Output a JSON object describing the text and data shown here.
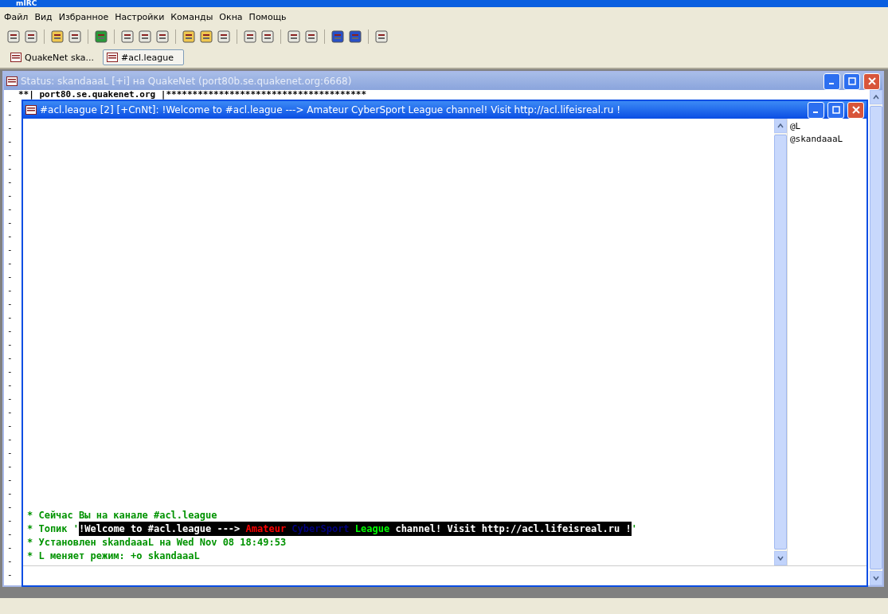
{
  "app_title": "mIRC",
  "menu": [
    "Файл",
    "Вид",
    "Избранное",
    "Настройки",
    "Команды",
    "Окна",
    "Помощь"
  ],
  "switchbar": [
    {
      "label": "QuakeNet ska...",
      "selected": false
    },
    {
      "label": "#acl.league",
      "selected": true
    }
  ],
  "status_window": {
    "title": "Status: skandaaaL [+i] на QuakeNet (port80b.se.quakenet.org:6668)",
    "first_line": "**| port80.se.quakenet.org |**************************************",
    "gutter": [
      "-",
      "-",
      "-",
      "-",
      "-",
      "-",
      "-",
      "-",
      "-",
      "-",
      "-",
      "-",
      "-",
      "-",
      "-",
      "-",
      "-",
      "-",
      "-",
      "-",
      "-",
      "-",
      "-",
      "-",
      "-",
      "-",
      "-",
      "-",
      "-",
      "-",
      "-",
      "-",
      "-",
      "-",
      "-",
      "-"
    ]
  },
  "channel_window": {
    "title": "#acl.league [2] [+CnNt]: !Welcome to #acl.league ---> Amateur CyberSport League channel! Visit http://acl.lifeisreal.ru !",
    "messages": [
      {
        "parts": [
          {
            "text": "* Сейчас Вы на канале #acl.league",
            "color": "#009300",
            "highlight": false
          }
        ]
      },
      {
        "parts": [
          {
            "text": "* Топик '",
            "color": "#009300",
            "highlight": false
          },
          {
            "text": "!Welcome to #acl.league ---> ",
            "color": "#ffffff",
            "highlight": true
          },
          {
            "text": "Amateur ",
            "color": "#ff0000",
            "highlight": true
          },
          {
            "text": "CyberSport ",
            "color": "#00007f",
            "highlight": true
          },
          {
            "text": "League ",
            "color": "#00fc00",
            "highlight": true
          },
          {
            "text": "channel! Visit http://acl.lifeisreal.ru !",
            "color": "#ffffff",
            "highlight": true
          },
          {
            "text": "'",
            "color": "#009300",
            "highlight": false
          }
        ]
      },
      {
        "parts": [
          {
            "text": "* Установлен skandaaaL на Wed Nov 08 18:49:53",
            "color": "#009300",
            "highlight": false
          }
        ]
      },
      {
        "parts": [
          {
            "text": "* L меняет режим: +o skandaaaL",
            "color": "#009300",
            "highlight": false
          }
        ]
      }
    ],
    "nicks": [
      "@L",
      "@skandaaaL"
    ]
  }
}
